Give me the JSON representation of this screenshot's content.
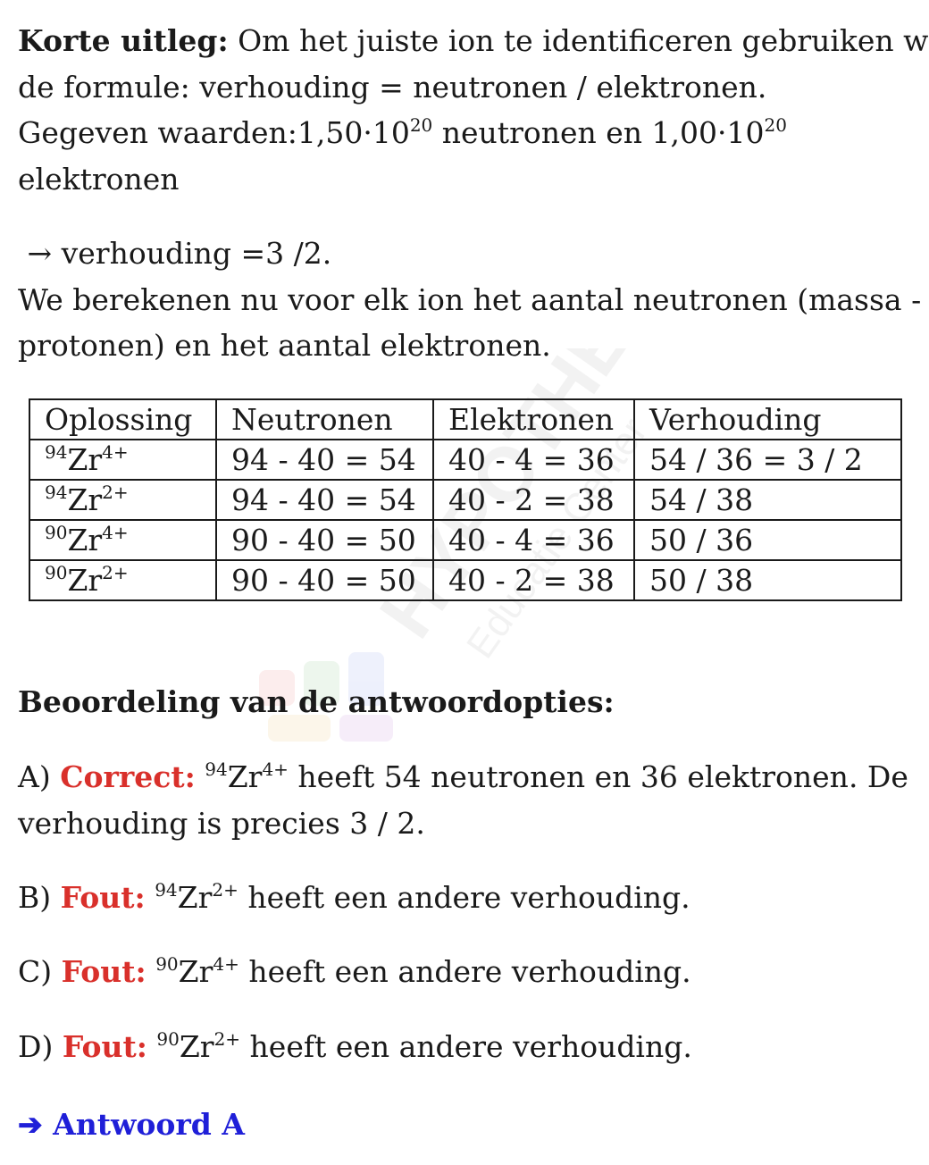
{
  "intro": {
    "heading": "Korte uitleg:",
    "line1_rest": " Om het juiste ion te identificeren gebruiken we",
    "line2": "de formule: verhouding = neutronen / elektronen.",
    "line3_a": "Gegeven waarden:1,50·10",
    "line3_exp1": "20",
    "line3_b": " neutronen en 1,00·10",
    "line3_exp2": "20",
    "line4": "elektronen",
    "ratio_line": " → verhouding =3 /2.",
    "line6": "We berekenen nu voor elk ion het aantal neutronen (massa -",
    "line7": "protonen) en het aantal elektronen."
  },
  "table": {
    "headers": [
      "Oplossing",
      "Neutronen",
      "Elektronen",
      "Verhouding"
    ],
    "rows": [
      {
        "mass": "94",
        "symbol": "Zr",
        "charge": "4+",
        "neutrons": "94 - 40 = 54",
        "electrons": "40 - 4 = 36",
        "ratio": "54 / 36 = 3 / 2"
      },
      {
        "mass": "94",
        "symbol": "Zr",
        "charge": "2+",
        "neutrons": "94 - 40 = 54",
        "electrons": "40 - 2 = 38",
        "ratio": "54 / 38"
      },
      {
        "mass": "90",
        "symbol": "Zr",
        "charge": "4+",
        "neutrons": "90 - 40 = 50",
        "electrons": "40 - 4 = 36",
        "ratio": "50 / 36"
      },
      {
        "mass": "90",
        "symbol": "Zr",
        "charge": "2+",
        "neutrons": "90 - 40 = 50",
        "electrons": "40 - 2 = 38",
        "ratio": "50 / 38"
      }
    ]
  },
  "assessment": {
    "heading": "Beoordeling van de antwoordopties:",
    "options": [
      {
        "letter": "A) ",
        "verdict": "Correct:",
        "mass": "94",
        "symbol": "Zr",
        "charge": "4+",
        "text": " heeft 54 neutronen en 36 elektronen. De",
        "text2": "verhouding is precies 3 / 2."
      },
      {
        "letter": "B) ",
        "verdict": "Fout:",
        "mass": "94",
        "symbol": "Zr",
        "charge": "2+",
        "text": " heeft een andere verhouding."
      },
      {
        "letter": "C) ",
        "verdict": "Fout:",
        "mass": "90",
        "symbol": "Zr",
        "charge": "4+",
        "text": " heeft een andere verhouding."
      },
      {
        "letter": "D) ",
        "verdict": "Fout:",
        "mass": "90",
        "symbol": "Zr",
        "charge": "2+",
        "text": " heeft een andere verhouding."
      }
    ]
  },
  "answer": {
    "arrow": "➔",
    "label": "Antwoord A"
  },
  "watermark": {
    "brand": "HYPOTHESE",
    "sub": "Educatie Center"
  },
  "colors": {
    "text": "#1a1a1a",
    "verdict": "#d9302b",
    "answer": "#1f1fd8"
  }
}
